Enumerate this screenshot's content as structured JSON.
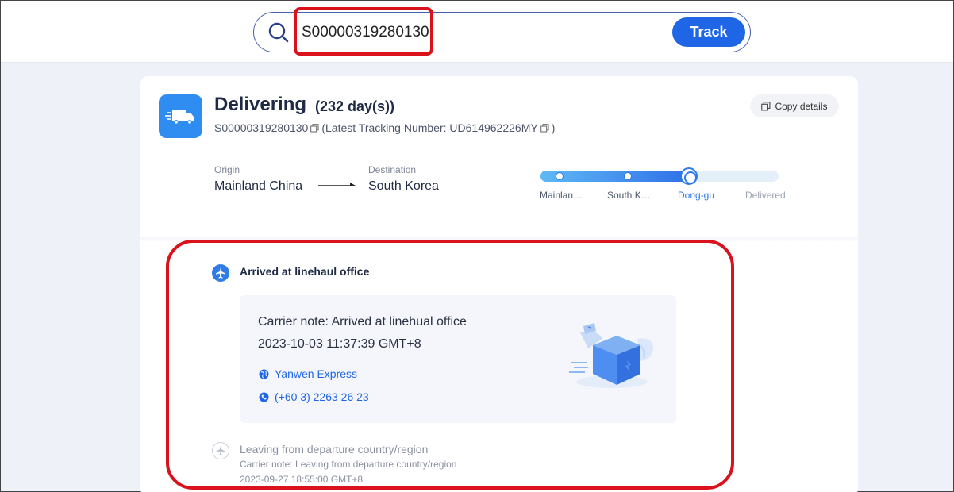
{
  "search": {
    "value": "S00000319280130",
    "track_label": "Track"
  },
  "shipment": {
    "status": "Delivering",
    "days": "(232 day(s))",
    "tracking_number": "S00000319280130",
    "latest_tracking": "(Latest Tracking Number: UD614962226MY",
    "latest_tracking_close": ")",
    "copy_details_label": "Copy details",
    "origin_label": "Origin",
    "origin_value": "Mainland China",
    "destination_label": "Destination",
    "destination_value": "South Korea"
  },
  "progress": {
    "fraction": 0.63,
    "stages": [
      {
        "label": "Mainlan…",
        "state": "done"
      },
      {
        "label": "South K…",
        "state": "done"
      },
      {
        "label": "Dong-gu",
        "state": "current"
      },
      {
        "label": "Delivered",
        "state": "pending"
      }
    ]
  },
  "events": [
    {
      "title": "Arrived at linehaul office",
      "note": "Carrier note: Arrived at linehual office",
      "time": "2023-10-03 11:37:39 GMT+8",
      "carrier": "Yanwen Express",
      "phone": "(+60 3) 2263 26 23",
      "icon": "airplane-icon"
    },
    {
      "title": "Leaving from departure country/region",
      "note": "Carrier note: Leaving from departure country/region",
      "time": "2023-09-27 18:55:00 GMT+8",
      "icon": "airplane-icon"
    }
  ],
  "colors": {
    "accent": "#1f66e6",
    "highlight": "#d9121b",
    "badge": "#2f8cf0"
  }
}
